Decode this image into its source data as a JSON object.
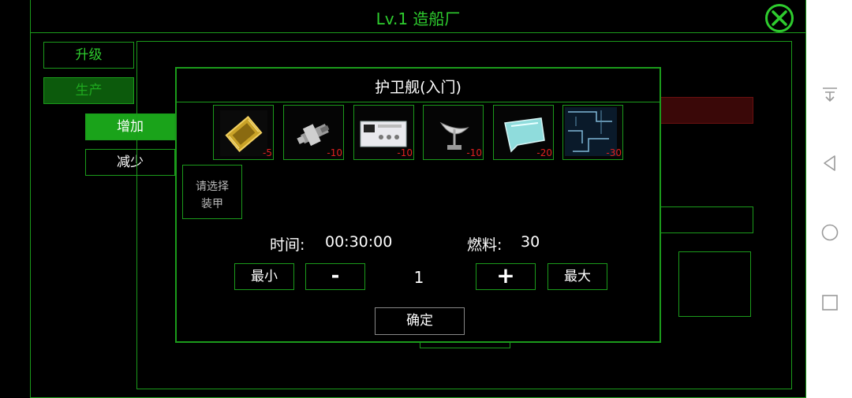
{
  "window": {
    "title": "Lv.1 造船厂"
  },
  "tabs": {
    "upgrade": "升级",
    "produce": "生产"
  },
  "actions": {
    "add": "增加",
    "reduce": "减少"
  },
  "dialog": {
    "title": "护卫舰(入门)",
    "components": [
      {
        "icon": "chip-icon",
        "cost": "-5"
      },
      {
        "icon": "spaceship-part-icon",
        "cost": "-10"
      },
      {
        "icon": "control-panel-icon",
        "cost": "-10"
      },
      {
        "icon": "satellite-dish-icon",
        "cost": "-10"
      },
      {
        "icon": "crystal-card-icon",
        "cost": "-20"
      },
      {
        "icon": "circuit-board-icon",
        "cost": "-30"
      }
    ],
    "armor_slot": {
      "line1": "请选择",
      "line2": "装甲"
    },
    "time_label": "时间:",
    "time_value": "00:30:00",
    "fuel_label": "燃料:",
    "fuel_value": "30",
    "min_label": "最小",
    "minus_label": "-",
    "quantity": "1",
    "plus_label": "+",
    "max_label": "最大",
    "confirm_label": "确定"
  },
  "colors": {
    "accent": "#1b9b1b",
    "text_green": "#2ecc2e",
    "cost_red": "#e02020"
  }
}
